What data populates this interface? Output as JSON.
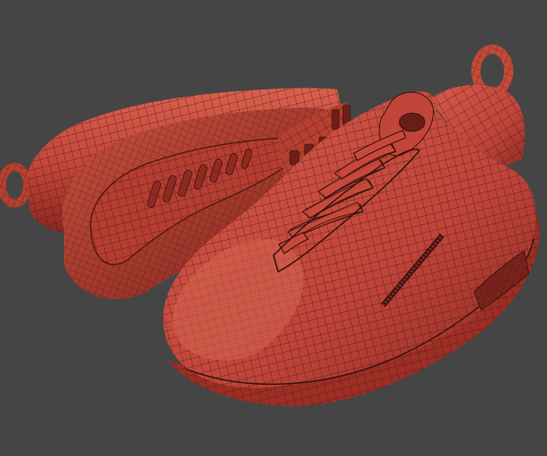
{
  "viewport": {
    "background": "#454545",
    "subject": "wireframe-sneaker-pair"
  },
  "colors": {
    "mesh_base": "#c8483a",
    "mesh_shadow": "#8f2a22",
    "mesh_highlight": "#e0705c",
    "wire": "#3a1410",
    "sole_dark": "#7a221c"
  }
}
